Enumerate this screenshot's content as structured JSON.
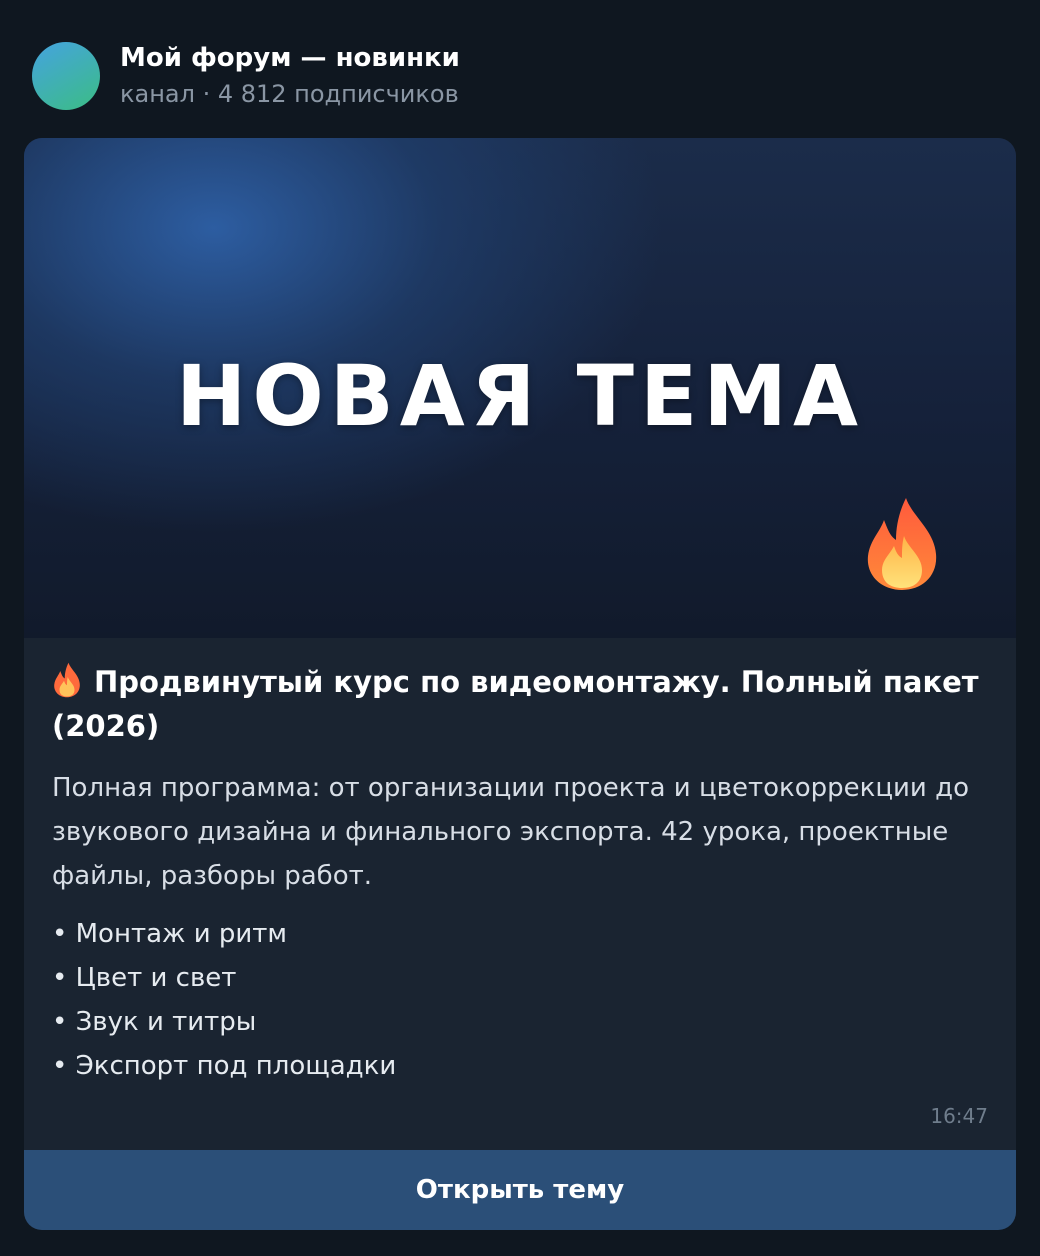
{
  "channel": {
    "title": "Мой форум — новинки",
    "meta": "канал · 4 812 подписчиков"
  },
  "post": {
    "banner_title": "НОВАЯ ТЕМА",
    "banner_icon": "fire-icon",
    "title_icon": "fire-icon",
    "title": "Продвинутый курс по видеомонтажу. Полный пакет (2026)",
    "description": "Полная программа: от организации проекта и цветокоррекции до звукового дизайна и финального экспорта. 42 урока, проектные файлы, разборы работ.",
    "bullets": [
      "• Монтаж и ритм",
      "• Цвет и свет",
      "• Звук и титры",
      "• Экспорт под площадки"
    ],
    "time": "16:47",
    "button_label": "Открыть тему"
  },
  "colors": {
    "background": "#0f1720",
    "card": "#1a2431",
    "button": "#2b4f78",
    "avatar_from": "#45a3e0",
    "avatar_to": "#3bbd84"
  }
}
